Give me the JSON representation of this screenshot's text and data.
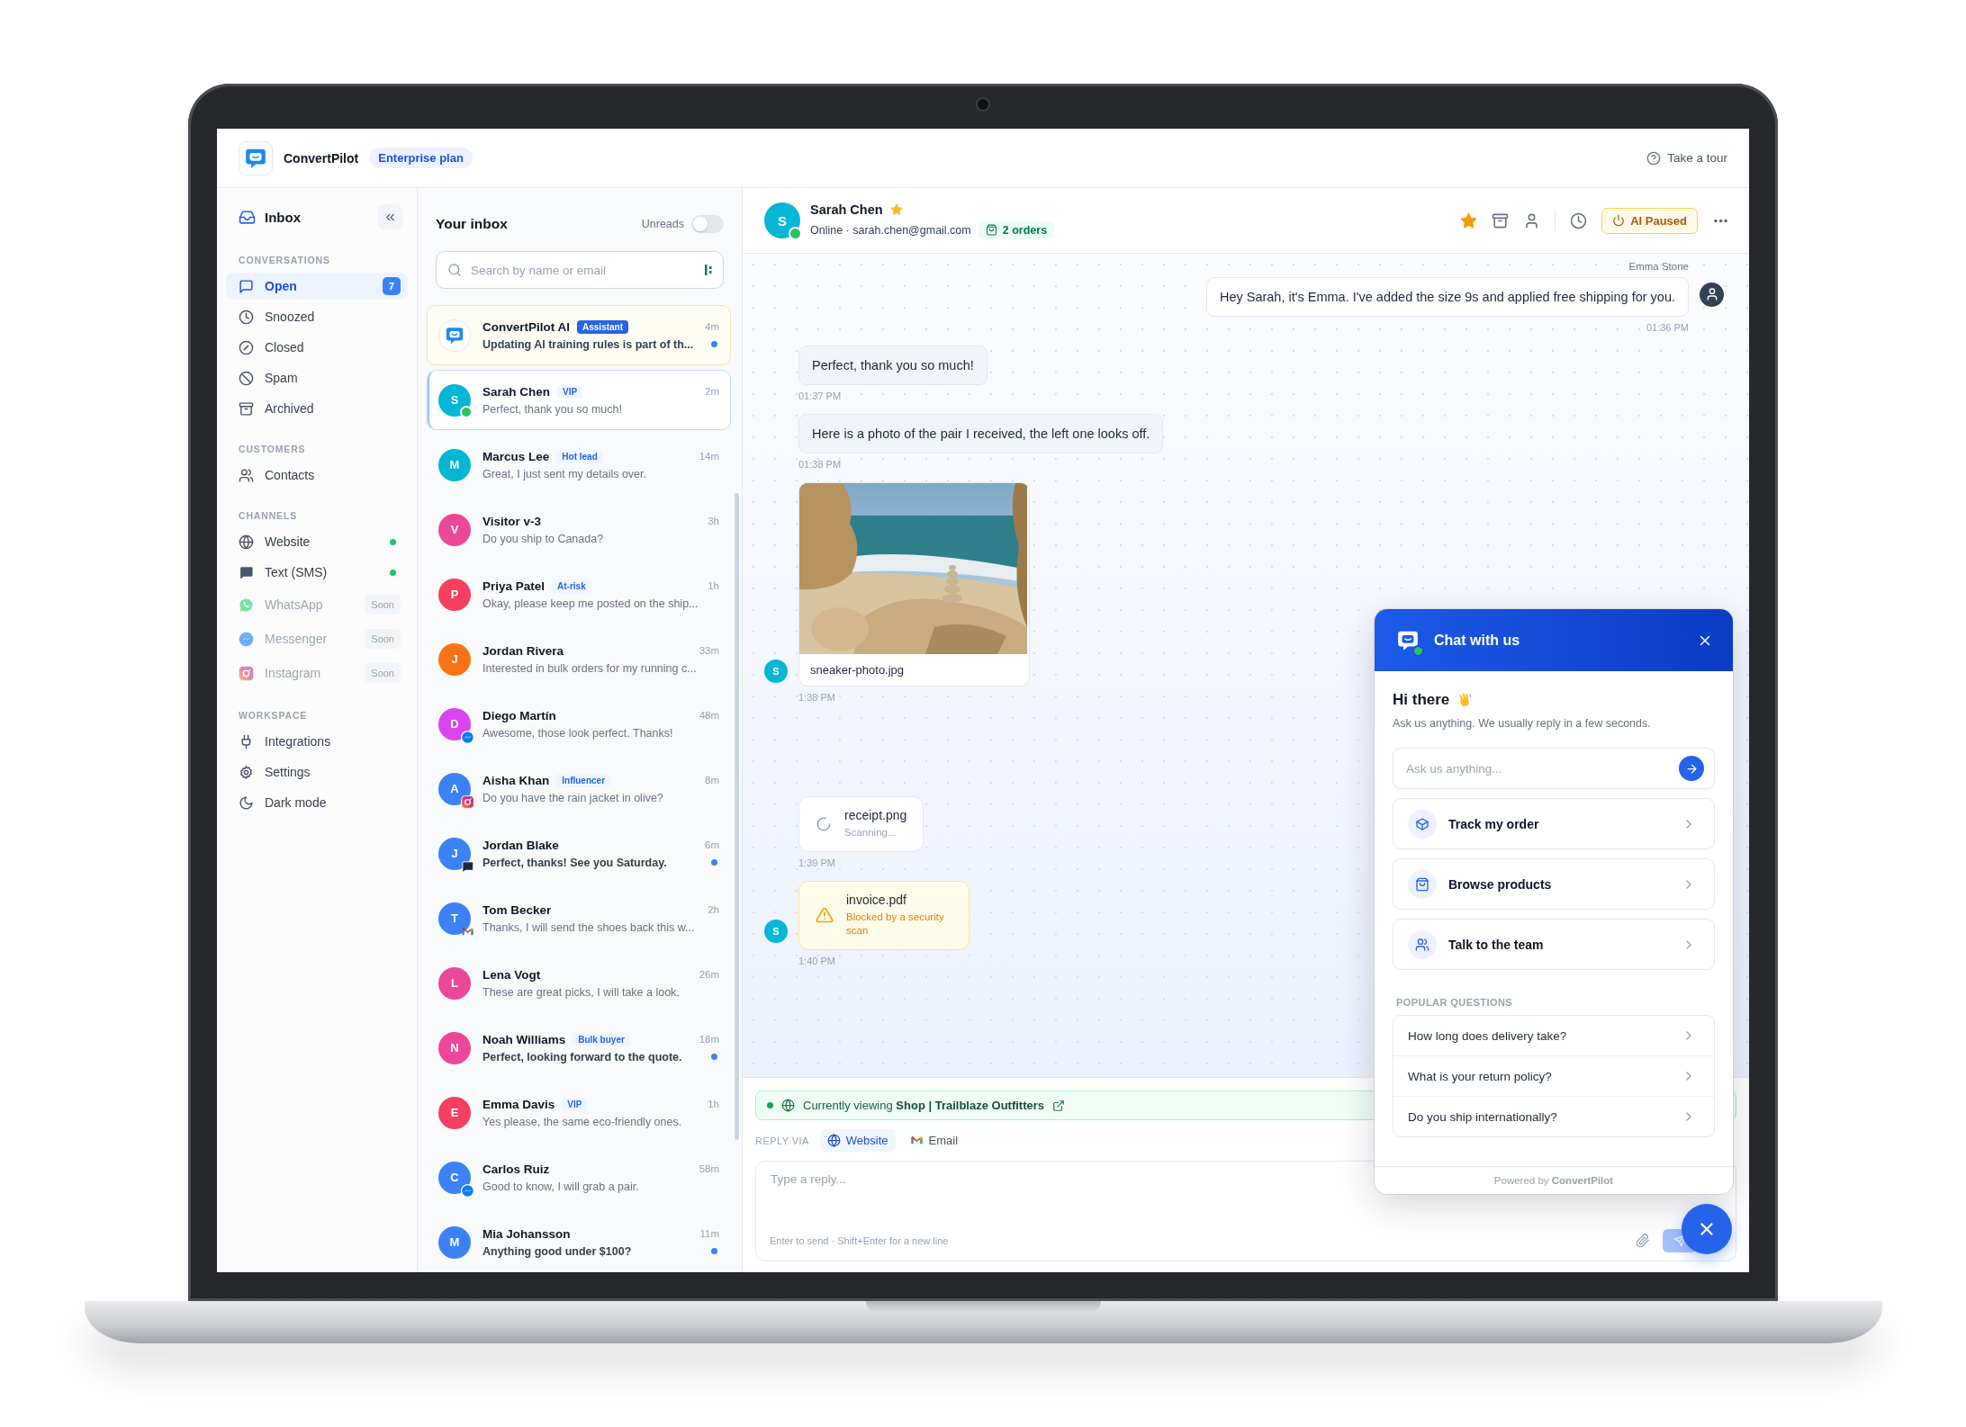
{
  "app": {
    "name": "ConvertPilot",
    "plan": "Enterprise plan",
    "tour": "Take a tour"
  },
  "sidebar": {
    "title": "Inbox",
    "sections": [
      {
        "title": "CONVERSATIONS",
        "items": [
          {
            "label": "Open",
            "selected": true,
            "disabled": false,
            "count": "7"
          },
          {
            "label": "Snoozed",
            "selected": false,
            "disabled": false
          },
          {
            "label": "Closed",
            "selected": false,
            "disabled": false
          },
          {
            "label": "Spam",
            "selected": false,
            "disabled": false
          },
          {
            "label": "Archived",
            "selected": false,
            "disabled": false
          }
        ]
      },
      {
        "title": "CUSTOMERS",
        "items": [
          {
            "label": "Contacts",
            "selected": false,
            "disabled": false
          }
        ]
      },
      {
        "title": "CHANNELS",
        "items": [
          {
            "label": "Website",
            "selected": false,
            "disabled": false,
            "online": true
          },
          {
            "label": "Text (SMS)",
            "selected": false,
            "disabled": false,
            "online": true
          },
          {
            "label": "WhatsApp",
            "selected": false,
            "disabled": true,
            "online": false,
            "badge": "Soon"
          },
          {
            "label": "Messenger",
            "selected": false,
            "disabled": true,
            "online": false,
            "badge": "Soon"
          },
          {
            "label": "Instagram",
            "selected": false,
            "disabled": true,
            "online": false,
            "badge": "Soon"
          }
        ]
      },
      {
        "title": "WORKSPACE",
        "items": [
          {
            "label": "Integrations",
            "selected": false,
            "disabled": false
          },
          {
            "label": "Settings",
            "selected": false,
            "disabled": false
          },
          {
            "label": "Dark mode",
            "selected": false,
            "disabled": false
          }
        ]
      }
    ]
  },
  "inbox": {
    "title": "Your inbox",
    "unreads": {
      "label": "Unreads",
      "on": false
    },
    "search": {
      "placeholder": "Search by name or email"
    },
    "conversations": [
      {
        "kind": "assistant",
        "name": "ConvertPilot AI",
        "tag": {
          "text": "Assistant",
          "kind": "solid"
        },
        "time": "4m",
        "preview": "Updating AI training rules is part of th...",
        "unread": true,
        "selected": false
      },
      {
        "kind": "contact",
        "name": "Sarah Chen",
        "initial": "S",
        "color": "#06b6d4",
        "channel": {
          "kind": "online"
        },
        "tag": {
          "text": "VIP",
          "kind": "soft"
        },
        "time": "2m",
        "preview": "Perfect, thank you so much!",
        "unread": false,
        "selected": true
      },
      {
        "kind": "contact",
        "name": "Marcus Lee",
        "initial": "M",
        "color": "#06b6d4",
        "tag": {
          "text": "Hot lead",
          "kind": "soft"
        },
        "time": "14m",
        "preview": "Great, I just sent my details over.",
        "unread": false,
        "selected": false
      },
      {
        "kind": "contact",
        "name": "Visitor v-3",
        "initial": "V",
        "color": "#ec4899",
        "time": "3h",
        "preview": "Do you ship to Canada?",
        "unread": false,
        "selected": false
      },
      {
        "kind": "contact",
        "name": "Priya Patel",
        "initial": "P",
        "color": "#f43f5e",
        "tag": {
          "text": "At-risk",
          "kind": "soft"
        },
        "time": "1h",
        "preview": "Okay, please keep me posted on the ship...",
        "unread": false,
        "selected": false
      },
      {
        "kind": "contact",
        "name": "Jordan Rivera",
        "initial": "J",
        "color": "#f97316",
        "time": "33m",
        "preview": "Interested in bulk orders for my running c...",
        "unread": false,
        "selected": false
      },
      {
        "kind": "contact",
        "name": "Diego Martín",
        "initial": "D",
        "color": "#d946ef",
        "channel": {
          "kind": "messenger"
        },
        "time": "48m",
        "preview": "Awesome, those look perfect. Thanks!",
        "unread": false,
        "selected": false
      },
      {
        "kind": "contact",
        "name": "Aisha Khan",
        "initial": "A",
        "color": "#3b82f6",
        "channel": {
          "kind": "instagram"
        },
        "tag": {
          "text": "Influencer",
          "kind": "soft"
        },
        "time": "8m",
        "preview": "Do you have the rain jacket in olive?",
        "unread": false,
        "selected": false
      },
      {
        "kind": "contact",
        "name": "Jordan Blake",
        "initial": "J",
        "color": "#3b82f6",
        "channel": {
          "kind": "sms"
        },
        "time": "6m",
        "preview": "Perfect, thanks! See you Saturday.",
        "unread": true,
        "selected": false
      },
      {
        "kind": "contact",
        "name": "Tom Becker",
        "initial": "T",
        "color": "#3b82f6",
        "channel": {
          "kind": "email"
        },
        "time": "2h",
        "preview": "Thanks, I will send the shoes back this w...",
        "unread": false,
        "selected": false
      },
      {
        "kind": "contact",
        "name": "Lena Vogt",
        "initial": "L",
        "color": "#ec4899",
        "time": "26m",
        "preview": "These are great picks, I will take a look.",
        "unread": false,
        "selected": false
      },
      {
        "kind": "contact",
        "name": "Noah Williams",
        "initial": "N",
        "color": "#ec4899",
        "tag": {
          "text": "Bulk buyer",
          "kind": "soft"
        },
        "time": "18m",
        "preview": "Perfect, looking forward to the quote.",
        "unread": true,
        "selected": false
      },
      {
        "kind": "contact",
        "name": "Emma Davis",
        "initial": "E",
        "color": "#f43f5e",
        "tag": {
          "text": "VIP",
          "kind": "soft"
        },
        "time": "1h",
        "preview": "Yes please, the same eco-friendly ones.",
        "unread": false,
        "selected": false
      },
      {
        "kind": "contact",
        "name": "Carlos Ruiz",
        "initial": "C",
        "color": "#3b82f6",
        "channel": {
          "kind": "messenger"
        },
        "time": "58m",
        "preview": "Good to know, I will grab a pair.",
        "unread": false,
        "selected": false
      },
      {
        "kind": "contact",
        "name": "Mia Johansson",
        "initial": "M",
        "color": "#3b82f6",
        "time": "11m",
        "preview": "Anything good under $100?",
        "unread": true,
        "selected": false
      }
    ]
  },
  "chat": {
    "contact": {
      "name": "Sarah Chen",
      "initial": "S",
      "color": "#06b6d4",
      "online": true,
      "starred": true,
      "status": "Online · sarah.chen@gmail.com",
      "orders": "2 orders"
    },
    "ai_button": "AI Paused",
    "messages": [
      {
        "kind": "text",
        "outgoing": true,
        "sender": "Emma Stone",
        "text": "Hey Sarah, it's Emma. I've added the size 9s and applied free shipping for you.",
        "time": "01:36 PM"
      },
      {
        "kind": "text",
        "outgoing": false,
        "text": "Perfect, thank you so much!",
        "time": "01:37 PM"
      },
      {
        "kind": "text",
        "outgoing": false,
        "text": "Here is a photo of the pair I received, the left one looks off.",
        "time": "01:38 PM"
      },
      {
        "outgoing": false,
        "filename": "sneaker-photo.jpg",
        "avatar": "S",
        "time": "1:38 PM"
      },
      {
        "kind": "file",
        "outgoing": false,
        "filename": "receipt.png",
        "blocked": false,
        "status": "Scanning...",
        "time": "1:39 PM"
      },
      {
        "kind": "file",
        "outgoing": false,
        "filename": "invoice.pdf",
        "blocked": true,
        "status": "Blocked by a security scan",
        "avatar": "S",
        "time": "1:40 PM"
      }
    ],
    "viewing": "Currently viewing **Shop | Trailblaze Outfitters**",
    "reply": {
      "label": "REPLY VIA",
      "channels": [
        {
          "label": "Website",
          "selected": true
        },
        {
          "label": "Email",
          "selected": false
        }
      ],
      "placeholder": "Type a reply...",
      "hint": "Enter to send · Shift+Enter for a new line",
      "send_disabled": true
    }
  },
  "widget": {
    "title": "Chat with us",
    "online": true,
    "greeting": "Hi there",
    "subtitle": "Ask us anything. We usually reply in a few seconds.",
    "placeholder": "Ask us anything...",
    "options": [
      "Track my order",
      "Browse products",
      "Talk to the team"
    ],
    "popular_title": "POPULAR QUESTIONS",
    "questions": [
      "How long does delivery take?",
      "What is your return policy?",
      "Do you ship internationally?"
    ],
    "footer": "Powered by **ConvertPilot**"
  }
}
